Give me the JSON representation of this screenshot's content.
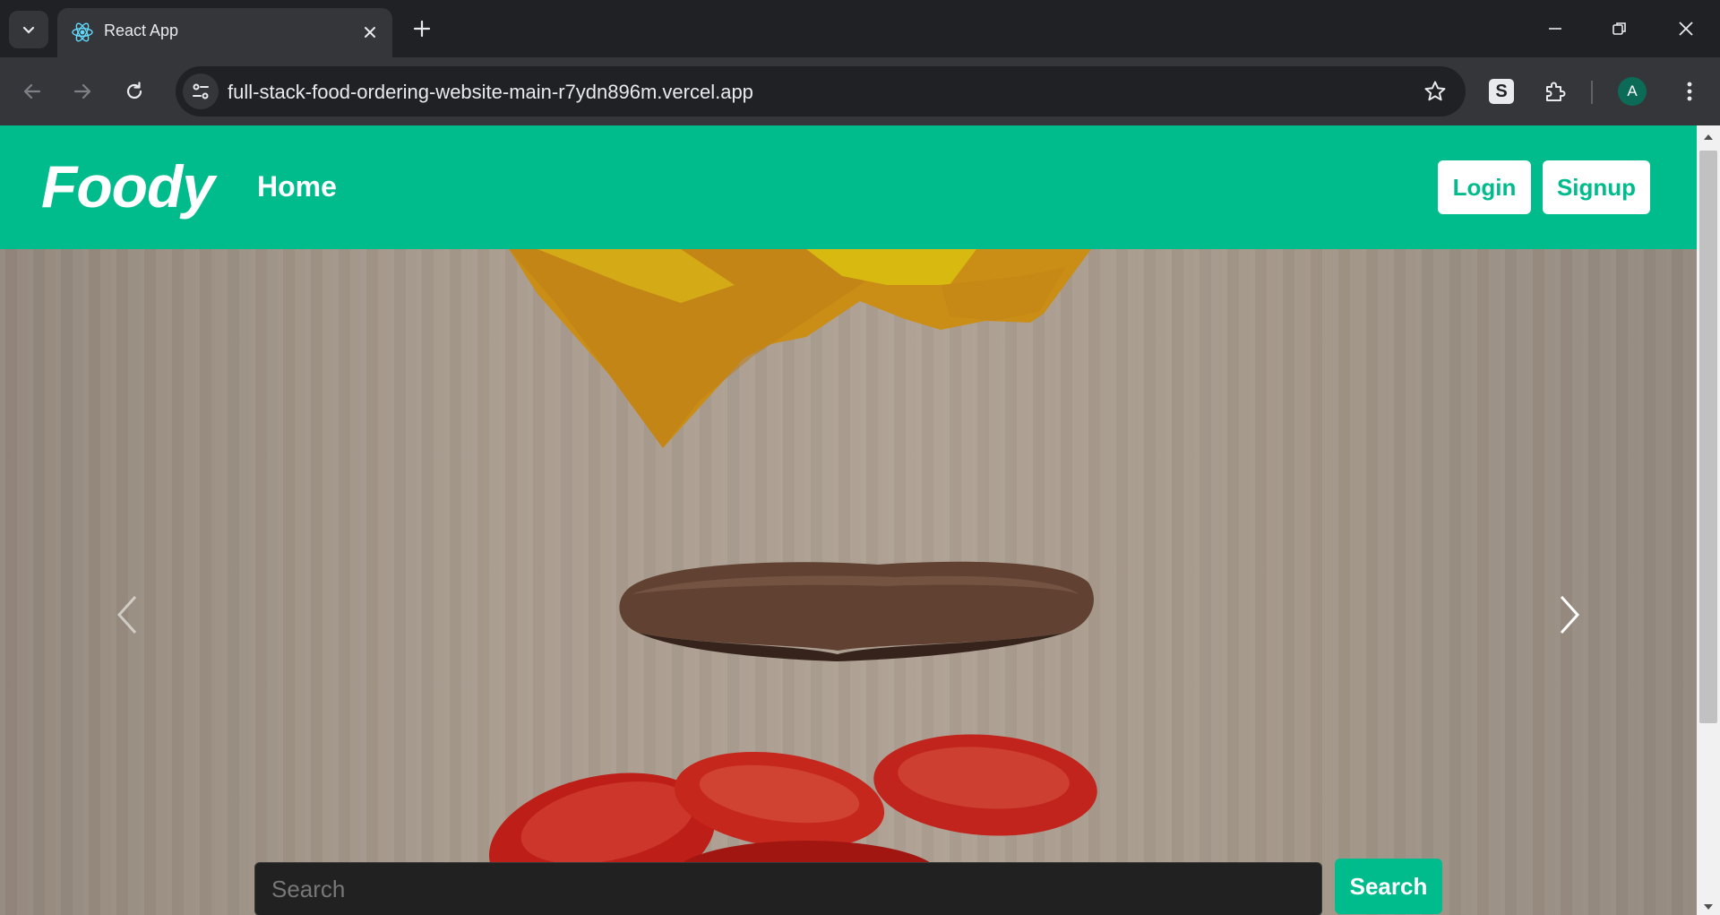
{
  "browser": {
    "tab_title": "React App",
    "url": "full-stack-food-ordering-website-main-r7ydn896m.vercel.app",
    "extension_label": "S",
    "profile_initial": "A"
  },
  "navbar": {
    "brand": "Foody",
    "home_label": "Home",
    "login_label": "Login",
    "signup_label": "Signup"
  },
  "search": {
    "placeholder": "Search",
    "button_label": "Search"
  },
  "colors": {
    "brand_green": "#00bc8c",
    "browser_dark": "#202124",
    "toolbar": "#35363a"
  },
  "icons": [
    "tab-search-icon",
    "react-icon",
    "close-icon",
    "plus-icon",
    "minimize-icon",
    "restore-icon",
    "back-icon",
    "forward-icon",
    "reload-icon",
    "site-settings-icon",
    "star-icon",
    "puzzle-icon",
    "kebab-icon",
    "chevron-left-icon",
    "chevron-right-icon"
  ]
}
